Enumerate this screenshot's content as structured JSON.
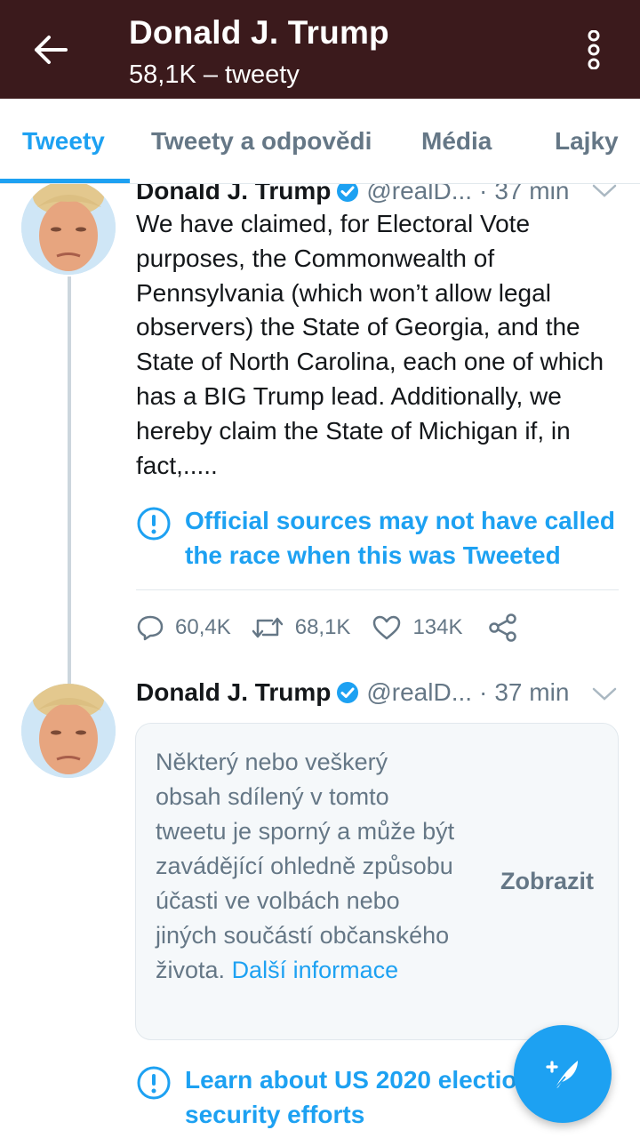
{
  "header": {
    "title": "Donald J. Trump",
    "subtitle": "58,1K – tweety",
    "back_icon": "arrow-left-icon",
    "more_icon": "more-vertical-icon",
    "background_color": "#3b1a1c"
  },
  "tabs": [
    {
      "label": "Tweety",
      "active": true
    },
    {
      "label": "Tweety a odpovědi",
      "active": false
    },
    {
      "label": "Média",
      "active": false
    },
    {
      "label": "Lajky",
      "active": false
    }
  ],
  "tweets": [
    {
      "author": "Donald J. Trump",
      "handle": "@realD...",
      "separator": "·",
      "time": "37 min",
      "text": "We have claimed, for Electoral Vote purposes, the Commonwealth of Pennsylvania (which won’t allow legal observers) the State of Georgia, and the State of North Carolina, each one of which has a BIG Trump lead. Additionally, we hereby claim the State of Michigan if, in fact,.....",
      "notice": "Official sources may not have called the race when this was Tweeted",
      "replies": "60,4K",
      "retweets": "68,1K",
      "likes": "134K"
    },
    {
      "author": "Donald J. Trump",
      "handle": "@realD...",
      "separator": "·",
      "time": "37 min",
      "sensitive_text": "Některý nebo veškerý obsah sdílený v tomto tweetu je sporný a může být zavádějící ohledně způsobu účasti ve volbách nebo jiných součástí občanského života.",
      "sensitive_link": "Další informace",
      "show_label": "Zobrazit",
      "notice": "Learn about US 2020 election security efforts"
    }
  ],
  "colors": {
    "accent": "#1da1f2",
    "muted": "#657786",
    "divider": "#e1e8ed"
  },
  "fab_icon": "compose-tweet-icon"
}
